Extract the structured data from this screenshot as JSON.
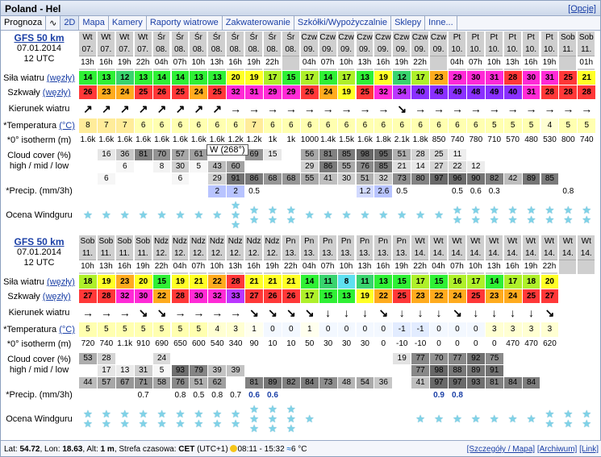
{
  "title": "Poland - Hel",
  "options": "[Opcje]",
  "tabs": [
    "Prognoza",
    "2D",
    "Mapa",
    "Kamery",
    "Raporty wiatrowe",
    "Zakwaterowanie",
    "Szkółki/Wypożyczalnie",
    "Sklepy",
    "Inne..."
  ],
  "labels": {
    "model": "GFS 50 km",
    "date": "07.01.2014",
    "run": "12 UTC",
    "wind": "Siła wiatru",
    "gusts": "Szkwały",
    "unit_w": "(węzły)",
    "dir": "Kierunek wiatru",
    "temp": "*Temperatura",
    "unit_t": "(°C)",
    "iso": "*0° isotherm (m)",
    "cloud1": "Cloud cover (%)",
    "cloud2": "high / mid / low",
    "precip": "*Precip. (mm/3h)",
    "rating": "Ocena Windguru"
  },
  "tooltip": "W (268°)",
  "blocks": [
    {
      "day": [
        "Wt",
        "Wt",
        "Wt",
        "Wt",
        "Śr",
        "Śr",
        "Śr",
        "Śr",
        "Śr",
        "Śr",
        "Śr",
        "Śr",
        "Czw",
        "Czw",
        "Czw",
        "Czw",
        "Czw",
        "Czw",
        "Czw",
        "Czw",
        "Pt",
        "Pt",
        "Pt",
        "Pt",
        "Pt",
        "Pt",
        "Sob",
        "Sob"
      ],
      "date": [
        "07.",
        "07.",
        "07.",
        "07.",
        "08.",
        "08.",
        "08.",
        "08.",
        "08.",
        "08.",
        "08.",
        "08.",
        "09.",
        "09.",
        "09.",
        "09.",
        "09.",
        "09.",
        "09.",
        "09.",
        "10.",
        "10.",
        "10.",
        "10.",
        "10.",
        "10.",
        "11.",
        "11."
      ],
      "hour": [
        "13h",
        "16h",
        "19h",
        "22h",
        "04h",
        "07h",
        "10h",
        "13h",
        "16h",
        "19h",
        "22h",
        "",
        "04h",
        "07h",
        "10h",
        "13h",
        "16h",
        "19h",
        "22h",
        "",
        "04h",
        "07h",
        "10h",
        "13h",
        "16h",
        "19h",
        "",
        "01h"
      ],
      "wind": [
        14,
        13,
        12,
        13,
        14,
        14,
        13,
        13,
        20,
        19,
        17,
        15,
        17,
        14,
        17,
        13,
        19,
        12,
        17,
        23,
        29,
        30,
        31,
        28,
        30,
        31,
        25,
        21
      ],
      "gust": [
        26,
        23,
        24,
        25,
        26,
        25,
        24,
        25,
        32,
        31,
        29,
        29,
        26,
        24,
        19,
        25,
        32,
        34,
        40,
        48,
        49,
        48,
        49,
        40,
        31,
        28,
        28,
        28
      ],
      "dir": [
        "↗",
        "↗",
        "↗",
        "↗",
        "↗",
        "↗",
        "↗",
        "↗",
        "→",
        "→",
        "→",
        "→",
        "→",
        "→",
        "→",
        "→",
        "→",
        "↘",
        "→",
        "→",
        "→",
        "→",
        "→",
        "→",
        "→",
        "→",
        "→",
        "→"
      ],
      "temp": [
        8,
        7,
        7,
        6,
        6,
        6,
        6,
        6,
        6,
        7,
        6,
        6,
        6,
        6,
        6,
        6,
        6,
        6,
        6,
        6,
        6,
        6,
        5,
        5,
        5,
        4,
        5,
        5
      ],
      "iso": [
        "1.6k",
        "1.6k",
        "1.6k",
        "1.6k",
        "1.6k",
        "1.6k",
        "1.6k",
        "1.6k",
        "1.2k",
        "1.2k",
        "1k",
        "1k",
        "1000",
        "1.4k",
        "1.5k",
        "1.6k",
        "1.8k",
        "2.1k",
        "1.8k",
        "850",
        "740",
        "780",
        "710",
        "570",
        "480",
        "530",
        "800",
        "740"
      ],
      "high": [
        "",
        "16",
        "36",
        "81",
        "70",
        "57",
        "61",
        "",
        "",
        "69",
        "15",
        "",
        "56",
        "81",
        "85",
        "98",
        "95",
        "51",
        "28",
        "25",
        "11",
        "",
        "",
        "",
        "",
        "",
        "",
        ""
      ],
      "mid": [
        "",
        "",
        "6",
        "",
        "8",
        "30",
        "5",
        "43",
        "60",
        "",
        "",
        "",
        "29",
        "86",
        "55",
        "76",
        "85",
        "21",
        "14",
        "27",
        "22",
        "12",
        "",
        "",
        "",
        "",
        "",
        ""
      ],
      "low": [
        "",
        "6",
        "",
        "",
        "",
        "6",
        "",
        "29",
        "91",
        "86",
        "68",
        "68",
        "55",
        "41",
        "30",
        "51",
        "32",
        "73",
        "80",
        "97",
        "96",
        "90",
        "82",
        "42",
        "89",
        "85"
      ],
      "precip": [
        "",
        "",
        "",
        "",
        "",
        "",
        "",
        "2",
        "2",
        "0.5",
        "",
        "",
        "",
        "",
        "",
        "1.2",
        "2.6",
        "0.5",
        "",
        "",
        "0.5",
        "0.6",
        "0.3",
        "",
        "",
        "",
        "0.8",
        ""
      ],
      "stars": [
        1,
        1,
        1,
        1,
        1,
        1,
        1,
        1,
        3,
        2,
        2,
        2,
        1,
        1,
        1,
        1,
        1,
        1,
        1,
        1,
        2,
        2,
        2,
        2,
        2,
        2,
        2,
        2
      ]
    },
    {
      "day": [
        "Sob",
        "Sob",
        "Sob",
        "Sob",
        "Ndz",
        "Ndz",
        "Ndz",
        "Ndz",
        "Ndz",
        "Ndz",
        "Ndz",
        "Pn",
        "Pn",
        "Pn",
        "Pn",
        "Pn",
        "Pn",
        "Pn",
        "Wt",
        "Wt",
        "Wt",
        "Wt",
        "Wt",
        "Wt",
        "Wt",
        "Wt",
        "Wt",
        "Wt"
      ],
      "date": [
        "11.",
        "11.",
        "11.",
        "11.",
        "12.",
        "12.",
        "12.",
        "12.",
        "12.",
        "12.",
        "12.",
        "13.",
        "13.",
        "13.",
        "13.",
        "13.",
        "13.",
        "13.",
        "14.",
        "14.",
        "14.",
        "14.",
        "14.",
        "14.",
        "14.",
        "14.",
        "14.",
        "14."
      ],
      "hour": [
        "10h",
        "13h",
        "16h",
        "19h",
        "22h",
        "04h",
        "07h",
        "10h",
        "13h",
        "16h",
        "19h",
        "22h",
        "04h",
        "07h",
        "10h",
        "13h",
        "16h",
        "19h",
        "22h",
        "04h",
        "07h",
        "10h",
        "13h",
        "16h",
        "19h",
        "22h",
        "",
        ""
      ],
      "wind": [
        18,
        19,
        23,
        20,
        15,
        19,
        21,
        22,
        28,
        21,
        21,
        21,
        14,
        11,
        8,
        11,
        13,
        15,
        17,
        15,
        16,
        17,
        14,
        17,
        18,
        20,
        "",
        ""
      ],
      "gust": [
        27,
        28,
        32,
        30,
        22,
        28,
        30,
        32,
        33,
        27,
        26,
        26,
        17,
        15,
        13,
        19,
        22,
        25,
        23,
        22,
        24,
        25,
        23,
        24,
        25,
        27,
        "",
        ""
      ],
      "dir": [
        "→",
        "→",
        "→",
        "↘",
        "↘",
        "→",
        "→",
        "→",
        "→",
        "↘",
        "↘",
        "↘",
        "↘",
        "↓",
        "↓",
        "↓",
        "↘",
        "↓",
        "↓",
        "↓",
        "↘",
        "↓",
        "↓",
        "↓",
        "↓",
        "↘",
        "",
        ""
      ],
      "temp": [
        5,
        5,
        5,
        5,
        5,
        5,
        5,
        4,
        3,
        1,
        0,
        0,
        1,
        0,
        0,
        0,
        0,
        -1,
        -1,
        0,
        0,
        0,
        3,
        3,
        3,
        3,
        "",
        ""
      ],
      "iso": [
        "720",
        "740",
        "1.1k",
        "910",
        "690",
        "650",
        "600",
        "540",
        "340",
        "90",
        "10",
        "10",
        "50",
        "30",
        "30",
        "30",
        "0",
        "-10",
        "-10",
        "0",
        "0",
        "0",
        "0",
        "470",
        "470",
        "620",
        "",
        ""
      ],
      "high": [
        "53",
        "28",
        "",
        "",
        "24",
        "",
        "",
        "",
        "",
        "",
        "",
        "",
        "",
        "",
        "",
        "",
        "",
        "19",
        "77",
        "70",
        "77",
        "92",
        "75",
        "",
        "",
        "",
        "",
        ""
      ],
      "mid": [
        "",
        "17",
        "13",
        "31",
        "5",
        "93",
        "79",
        "39",
        "39",
        "",
        "",
        "",
        "",
        "",
        "",
        "",
        "",
        "",
        "77",
        "98",
        "88",
        "89",
        "91",
        "",
        "",
        "",
        "",
        ""
      ],
      "low": [
        "44",
        "57",
        "67",
        "71",
        "58",
        "76",
        "51",
        "62",
        "",
        "81",
        "89",
        "82",
        "84",
        "73",
        "48",
        "54",
        "36",
        "",
        "41",
        "97",
        "97",
        "93",
        "81",
        "84",
        "84",
        "",
        "",
        ""
      ],
      "precip": [
        "",
        "",
        "",
        "0.7",
        "",
        "0.8",
        "0.5",
        "0.8",
        "0.7",
        "0.6",
        "0.6",
        "",
        "",
        "",
        "",
        "",
        "",
        "",
        "",
        "0.9",
        "0.8",
        "",
        "",
        "",
        "",
        "",
        "",
        ""
      ],
      "stars": [
        2,
        2,
        2,
        2,
        2,
        2,
        2,
        2,
        2,
        3,
        3,
        3,
        1,
        0,
        0,
        0,
        0,
        0,
        1,
        1,
        1,
        1,
        1,
        1,
        1,
        2,
        2,
        2
      ]
    }
  ],
  "footer": {
    "lat": "54.72",
    "lon": "18.63",
    "alt": "1 m",
    "tz": "CET",
    "utc": "(UTC+1)",
    "sun": "08:11 - 15:32",
    "water": "6 °C",
    "links": [
      "[Szczegóły / Mapa]",
      "[Archiwum]",
      "[Link]"
    ]
  }
}
